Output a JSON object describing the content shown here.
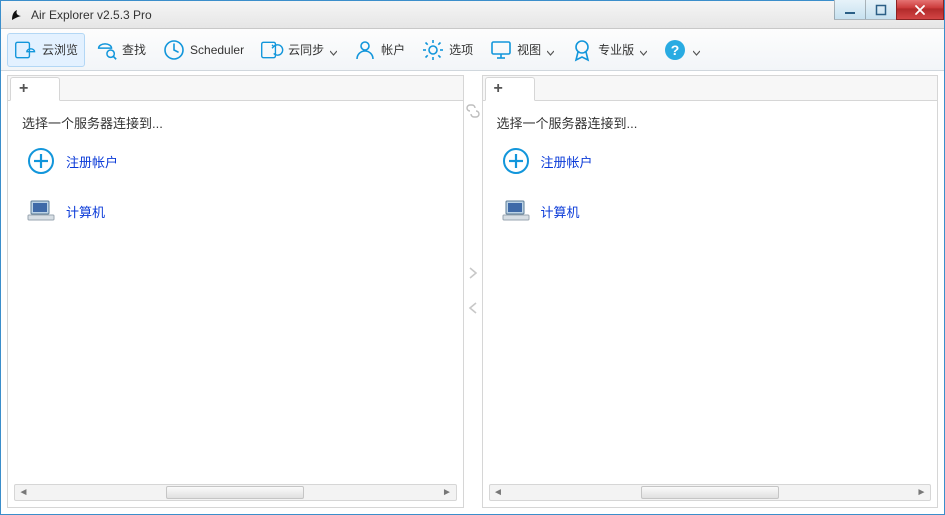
{
  "window": {
    "title": "Air Explorer v2.5.3 Pro"
  },
  "toolbar": {
    "browse": {
      "label": "云浏览"
    },
    "search": {
      "label": "查找"
    },
    "scheduler": {
      "label": "Scheduler"
    },
    "sync": {
      "label": "云同步"
    },
    "accounts": {
      "label": "帐户"
    },
    "options": {
      "label": "选项"
    },
    "view": {
      "label": "视图"
    },
    "pro": {
      "label": "专业版"
    }
  },
  "pane_left": {
    "prompt": "选择一个服务器连接到...",
    "register_label": "注册帐户",
    "computer_label": "计算机",
    "addtab_label": "+"
  },
  "pane_right": {
    "prompt": "选择一个服务器连接到...",
    "register_label": "注册帐户",
    "computer_label": "计算机",
    "addtab_label": "+"
  }
}
